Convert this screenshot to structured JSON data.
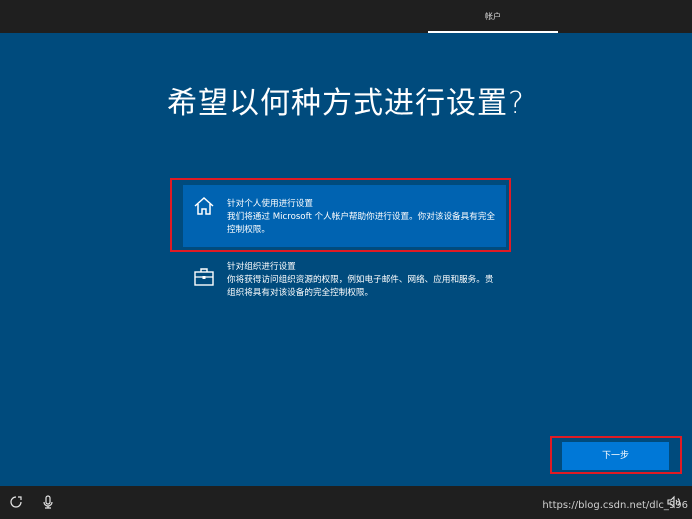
{
  "header": {
    "tab_label": "帐户"
  },
  "main": {
    "title": "希望以何种方式进行设置?",
    "options": [
      {
        "icon": "home-icon",
        "title": "针对个人使用进行设置",
        "description": "我们将通过 Microsoft 个人帐户帮助你进行设置。你对该设备具有完全控制权限。",
        "selected": true
      },
      {
        "icon": "briefcase-icon",
        "title": "针对组织进行设置",
        "description": "你将获得访问组织资源的权限，例如电子邮件、网络、应用和服务。贵组织将具有对该设备的完全控制权限。",
        "selected": false
      }
    ],
    "next_label": "下一步"
  },
  "footer": {
    "icons": [
      "ease-of-access-icon",
      "microphone-icon",
      "volume-icon"
    ],
    "watermark": "https://blog.csdn.net/dlc_996"
  },
  "colors": {
    "background": "#004b7d",
    "selected_option": "#0063b1",
    "button": "#0078d7",
    "highlight_box": "#e01b24",
    "bars": "#1f1f1f"
  }
}
